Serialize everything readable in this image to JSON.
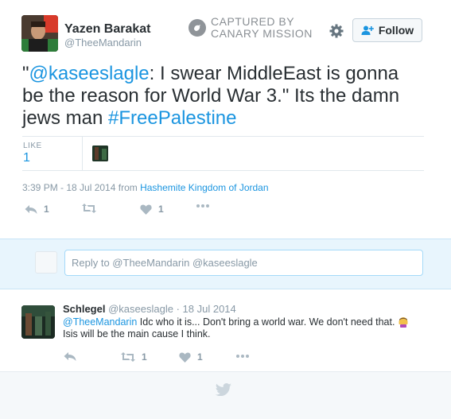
{
  "author": {
    "name": "Yazen Barakat",
    "handle": "@TheeMandarin"
  },
  "watermark": {
    "line1": "CAPTURED BY",
    "line2": "CANARY MISSION"
  },
  "follow_button": {
    "label": "Follow"
  },
  "tweet": {
    "open_quote": "\"",
    "mention": "@kaseeslagle",
    "text_mid": ": I swear MiddleEast is gonna be the reason for World War 3.\" Its the damn jews man ",
    "hashtag": "#FreePalestine",
    "like_label": "LIKE",
    "like_count": "1",
    "time": "3:39 PM - 18 Jul 2014",
    "from": "from",
    "location": "Hashemite Kingdom of Jordan",
    "actions": {
      "reply_count": "",
      "reply_count_shown": "1",
      "retweet_count": "",
      "like_count": "1"
    }
  },
  "reply_box": {
    "placeholder": "Reply to @TheeMandarin @kaseeslagle"
  },
  "reply": {
    "name": "Schlegel",
    "handle": "@kaseeslagle",
    "sep": "·",
    "date": "18 Jul 2014",
    "mention": "@TheeMandarin",
    "text": "Idc who it is... Don't bring a world war. We don't need that.",
    "text2": "Isis will be the main cause I think.",
    "retweet_count": "1",
    "like_count": "1"
  },
  "colors": {
    "link": "#1b95e0",
    "muted": "#8899a6",
    "reply_bg": "#e8f5fd"
  }
}
